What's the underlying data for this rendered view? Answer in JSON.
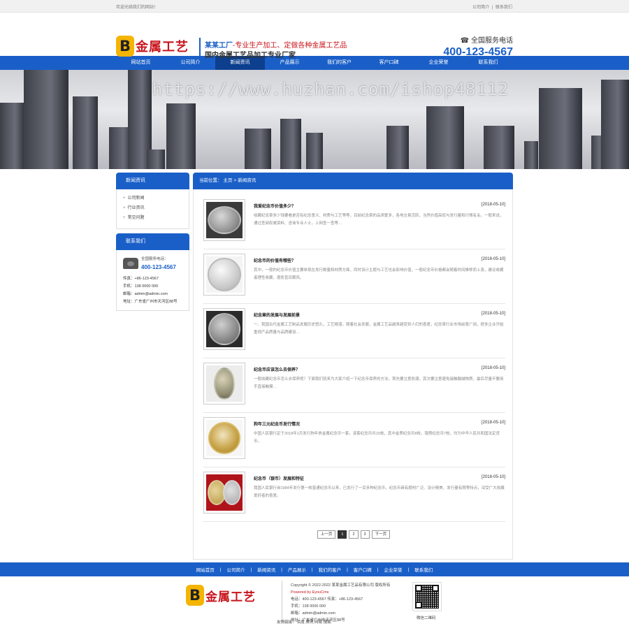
{
  "top": {
    "welcome": "欢迎光临我们的网站！",
    "links": [
      "公司简介",
      "|",
      "联系我们"
    ]
  },
  "header": {
    "logo_mark": "B",
    "logo_name": "金属工艺",
    "slogan_main": "某某工厂",
    "slogan_sub": "-专业生产加工、定做各种金属工艺品",
    "slogan_line2": "国内金属工艺品加工专业厂家",
    "hotline_label": "全国服务电话",
    "hotline_number": "400-123-4567"
  },
  "nav": [
    "网站首页",
    "公司简介",
    "新闻资讯",
    "产品展示",
    "我们的客户",
    "客户口碑",
    "企业荣誉",
    "联系我们"
  ],
  "nav_active": 2,
  "banner": {
    "watermark": "https://www.huzhan.com/ishop48112"
  },
  "sidebar": {
    "title": "新闻资讯",
    "items": [
      "公司新闻",
      "行业资讯",
      "常见问题"
    ],
    "contact_title": "联系我们",
    "contact_hotline_label": "全国服务电话：",
    "contact_hotline": "400-123-4567",
    "lines": [
      "传真：+86-123-4567",
      "手机：138 0000 000",
      "邮箱：admin@admin.com",
      "地址：广东省广州市天河区88号"
    ]
  },
  "breadcrumb": {
    "label": "当前位置：",
    "home": "主页",
    "sep": ">",
    "current": "新闻资讯"
  },
  "news": [
    {
      "title": "我爱纪念币价值多少？",
      "date": "[2018-05-10]",
      "desc": "收藏纪念章多少钱要看是否有纪念意义、材质与工艺等等，目前纪念章的品类繁多，各地交易活跃，当然价值高低与发行量和行情有关。一般来说，通过查阅权威资料、咨询专业人士，上网查一查等…",
      "thumb": "silver-round"
    },
    {
      "title": "纪念币的价值有哪些？",
      "date": "[2018-05-10]",
      "desc": "其中，一般的纪念币价值主要体现在发行数量和材质方面，同时设计主题与工艺也会影响价值，一般纪念币价格都会随着时间推移而上涨，建议收藏者理性收藏，避免盲目跟风。",
      "thumb": "silver-light"
    },
    {
      "title": "纪念章的发展与发展前景",
      "date": "[2018-05-10]",
      "desc": "一、我国古代金属工艺制品发展历史悠久，工艺精湛，随着社会发展，金属工艺品越来越受到人们的喜爱，纪念章行业市场前景广阔，很多企业开始重视产品质量与品牌建设…",
      "thumb": "silver-dark"
    },
    {
      "title": "纪念币应该怎么去保养？",
      "date": "[2018-05-10]",
      "desc": "一般收藏纪念币怎么去保养呢？下面我们就来为大家介绍一下纪念币保养的方法，首先要注意防潮，其次要注意避免接触酸碱物质，最后尽量不要用手直接触摸…",
      "thumb": "gold-oval"
    },
    {
      "title": "狗年三元纪念币发行情况",
      "date": "[2018-05-10]",
      "desc": "中国人民银行定于2018年1月发行狗年贵金属纪念币一套，该套纪念币共15枚，其中金质纪念币8枚，银质纪念币7枚，均为中华人民共和国法定货币。",
      "thumb": "gold-round"
    },
    {
      "title": "纪念币（银币）发展和特征",
      "date": "[2018-05-10]",
      "desc": "我国人民银行自1984年发行第一枚普通纪念币以来，已发行了一百多种纪念币，纪念币具有题材广泛、设计精美、发行量有限等特点，深受广大收藏爱好者的喜爱。",
      "thumb": "bimetal"
    }
  ],
  "pager": [
    "上一页",
    "1",
    "2",
    "3",
    "下一页"
  ],
  "footer_nav": [
    "网站首页",
    "公司简介",
    "新闻资讯",
    "产品展示",
    "我们的客户",
    "客户口碑",
    "企业荣誉",
    "联系我们"
  ],
  "footer": {
    "logo_mark": "B",
    "logo_name": "金属工艺",
    "copyright": "Copyright © 2022-2022 某某金属工艺品有限公司 版权所有",
    "powered": "Powered by EyouCms",
    "phone": "电话：400-123-4567 传真：+86-123-4567",
    "mobile": "手机：138 0000 000",
    "email": "邮箱：admin@admin.com",
    "address": "地址：广东省广州市天河区88号",
    "friend_links": "友情链接：  百度    腾讯    网易    搜狐",
    "qr_label": "微信二维码"
  }
}
